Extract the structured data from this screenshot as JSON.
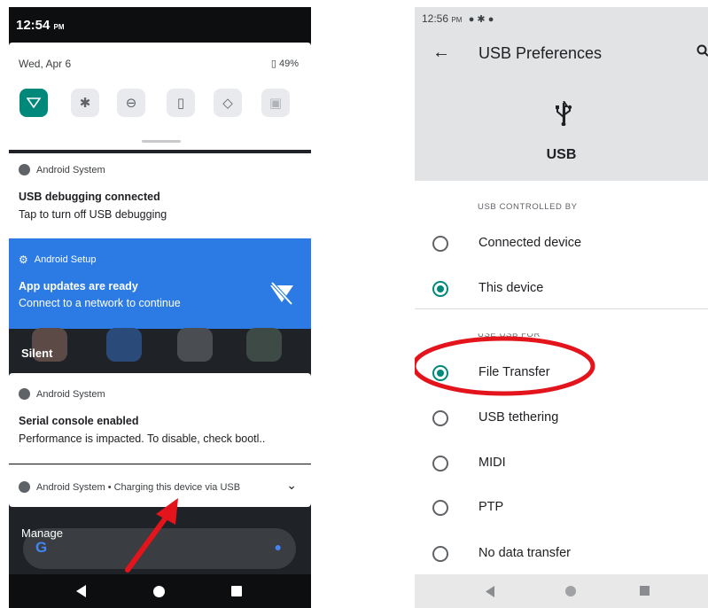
{
  "left_phone": {
    "status_time": "12:54",
    "status_ampm": "PM",
    "quick_settings": {
      "date": "Wed, Apr 6",
      "battery": "49%",
      "tiles": [
        {
          "icon": "wifi-icon",
          "active": true
        },
        {
          "icon": "bluetooth-icon",
          "active": false
        },
        {
          "icon": "do-not-disturb-icon",
          "active": false
        },
        {
          "icon": "flashlight-icon",
          "active": false
        },
        {
          "icon": "auto-rotate-icon",
          "active": false
        },
        {
          "icon": "battery-saver-icon",
          "active": false
        }
      ]
    },
    "notifications": [
      {
        "app": "Android System",
        "title": "USB debugging connected",
        "text": "Tap to turn off USB debugging"
      },
      {
        "app": "Android Setup",
        "title": "App updates are ready",
        "text": "Connect to a network to continue",
        "accent": "#2c7be5"
      }
    ],
    "silent_label": "Silent",
    "silent_notifications": [
      {
        "app": "Android System",
        "title": "Serial console enabled",
        "text": "Performance is impacted. To disable, check bootl.."
      },
      {
        "app": "Android System",
        "summary": "Android System • Charging this device via USB"
      }
    ],
    "manage_label": "Manage"
  },
  "right_phone": {
    "status_time": "12:56",
    "status_ampm": "PM",
    "title": "USB Preferences",
    "usb_label": "USB",
    "section_controlled": "USB CONTROLLED BY",
    "controlled_options": [
      {
        "label": "Connected device",
        "selected": false
      },
      {
        "label": "This device",
        "selected": true
      }
    ],
    "section_use": "USE USB FOR",
    "use_options": [
      {
        "label": "File Transfer",
        "selected": true
      },
      {
        "label": "USB tethering",
        "selected": false
      },
      {
        "label": "MIDI",
        "selected": false
      },
      {
        "label": "PTP",
        "selected": false
      },
      {
        "label": "No data transfer",
        "selected": false
      }
    ]
  },
  "colors": {
    "accent_teal": "#00897b",
    "annotation_red": "#e3141b",
    "setup_blue": "#2c7be5"
  }
}
